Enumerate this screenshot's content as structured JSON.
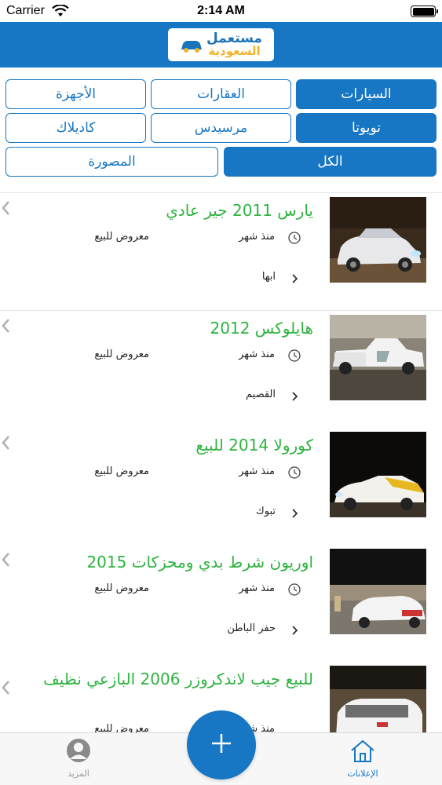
{
  "status_bar": {
    "carrier": "Carrier",
    "time": "2:14 AM"
  },
  "header": {
    "logo_line1": "مستعمل",
    "logo_line2": "السعودية"
  },
  "filters": {
    "row1": [
      "السيارات",
      "العقارات",
      "الأجهزة"
    ],
    "row2": [
      "تويوتا",
      "مرسيدس",
      "كاديلاك"
    ],
    "row3": [
      "الكل",
      "المصورة"
    ]
  },
  "listings": [
    {
      "title": "يارس 2011 جير عادي",
      "time": "منذ شهر",
      "status": "معروض للبيع",
      "location": "ابها"
    },
    {
      "title": "هايلوكس 2012",
      "time": "منذ شهر",
      "status": "معروض للبيع",
      "location": "القصيم"
    },
    {
      "title": "كورولا 2014 للبيع",
      "time": "منذ شهر",
      "status": "معروض للبيع",
      "location": "تبوك"
    },
    {
      "title": "اوريون شرط بدي ومحزكات 2015",
      "time": "منذ شهر",
      "status": "معروض للبيع",
      "location": "حفر الباطن"
    },
    {
      "title": "للبيع جيب لاندكروزر 2006 البازعي نظيف",
      "time": "منذ شهر",
      "status": "معروض للبيع",
      "location": ""
    }
  ],
  "tabbar": {
    "ads_label": "الإعلانات",
    "more_label": "المزيد"
  },
  "colors": {
    "primary": "#1777c4",
    "title_green": "#2db33e",
    "logo_yellow": "#f0b42a"
  }
}
